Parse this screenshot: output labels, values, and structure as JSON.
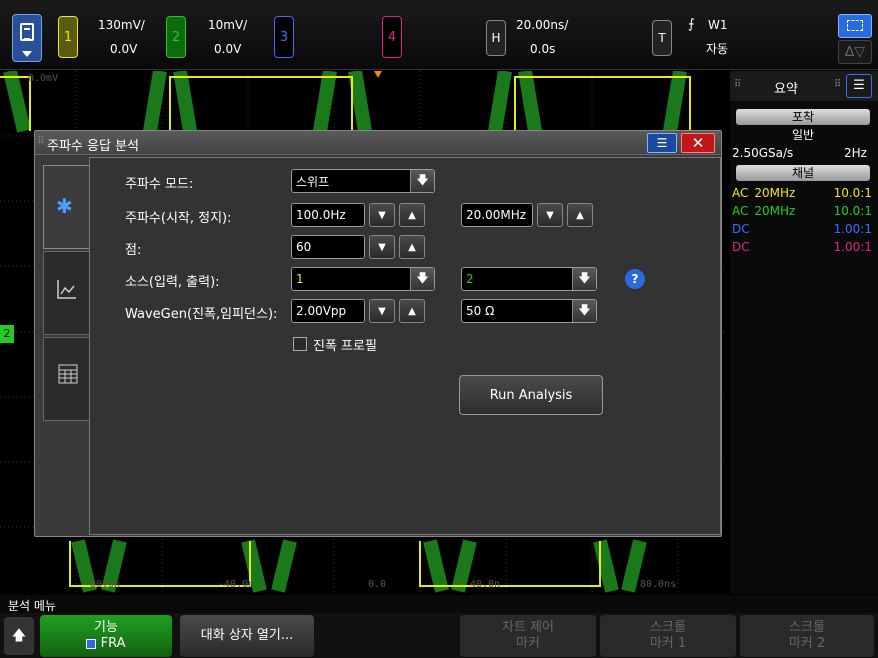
{
  "top": {
    "ch1": {
      "num": "1",
      "scale": "130mV/",
      "offset": "0.0V",
      "color": "#e8e81c"
    },
    "ch2": {
      "num": "2",
      "scale": "10mV/",
      "offset": "0.0V",
      "color": "#22cc22"
    },
    "ch3": {
      "num": "3",
      "color": "#3a6cff"
    },
    "ch4": {
      "num": "4",
      "color": "#e0208a"
    },
    "horiz": {
      "label": "H",
      "scale": "20.00ns/",
      "delay": "0.0s"
    },
    "trig": {
      "label": "T",
      "source": "W1",
      "mode": "자동"
    }
  },
  "plot": {
    "ref_level": "0.0mV",
    "time_labels": [
      "-80.0n",
      "-40.0n",
      "0.0",
      "40.0n",
      "80.0ns"
    ],
    "ground_marker": "2"
  },
  "right_panel": {
    "tab_summary": "요약",
    "acq_header": "포착",
    "acq_mode": "일반",
    "sample_rate": "2.50GSa/s",
    "freq": "2Hz",
    "chan_header": "채널",
    "channels": [
      {
        "coupling": "AC",
        "bw": "20MHz",
        "probe": "10.0:1",
        "color": "#e8e81c"
      },
      {
        "coupling": "AC",
        "bw": "20MHz",
        "probe": "10.0:1",
        "color": "#22cc22"
      },
      {
        "coupling": "DC",
        "bw": "",
        "probe": "1.00:1",
        "color": "#3a6cff"
      },
      {
        "coupling": "DC",
        "bw": "",
        "probe": "1.00:1",
        "color": "#e0208a"
      }
    ]
  },
  "dialog": {
    "title": "주파수 응답 분석",
    "mode_label": "주파수 모드:",
    "mode_value": "스위프",
    "freq_label": "주파수(시작, 정지):",
    "freq_start": "100.0Hz",
    "freq_stop": "20.00MHz",
    "points_label": "점:",
    "points_value": "60",
    "source_label": "소스(입력, 출력):",
    "source_in": "1",
    "source_out": "2",
    "wavegen_label": "WaveGen(진폭,임피던스):",
    "wavegen_amp": "2.00Vpp",
    "wavegen_imp": "50 Ω",
    "amp_profile_label": "진폭 프로필",
    "amp_profile_checked": false,
    "run_button": "Run Analysis",
    "help": "?"
  },
  "bottom": {
    "menu_title": "분석 메뉴",
    "key1_top": "기능",
    "key1_bottom": "FRA",
    "key2": "대화 상자 열기...",
    "key3_top": "차트 제어",
    "key3_bottom": "마커",
    "key4_top": "스크롤",
    "key4_bottom": "마커 1",
    "key5_top": "스크롤",
    "key5_bottom": "마커 2"
  }
}
